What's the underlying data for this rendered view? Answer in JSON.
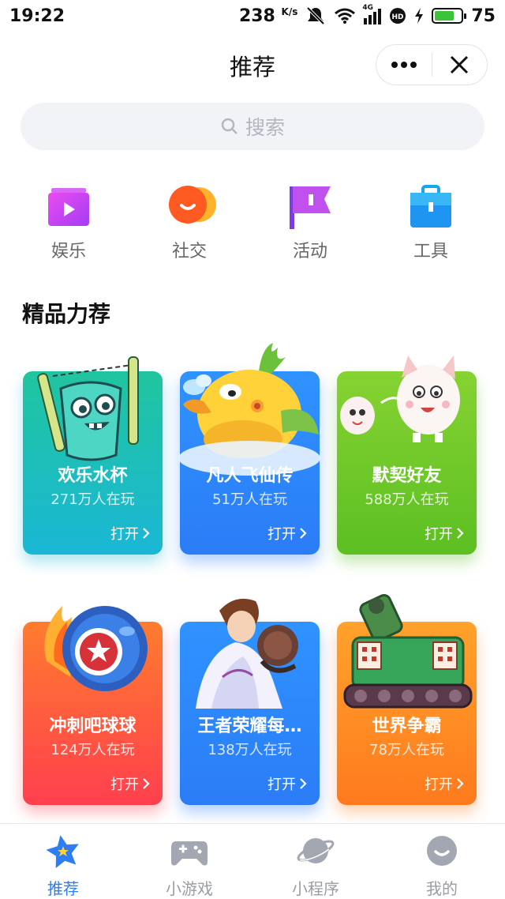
{
  "status_bar": {
    "time": "19:22",
    "speed_value": "238",
    "speed_unit": "K/s",
    "network": "4G",
    "battery": "75",
    "battery_level": 0.75
  },
  "header": {
    "title": "推荐",
    "more_icon": "more-dots-icon",
    "close_icon": "close-icon"
  },
  "search": {
    "placeholder": "搜索"
  },
  "categories": [
    {
      "label": "娱乐",
      "icon": "play-icon",
      "color": "#c53cf3"
    },
    {
      "label": "社交",
      "icon": "chat-bubble-icon",
      "color": "#ff5a22"
    },
    {
      "label": "活动",
      "icon": "flag-icon",
      "color": "#a54cf0"
    },
    {
      "label": "工具",
      "icon": "toolbox-icon",
      "color": "#1f95f2"
    }
  ],
  "section": {
    "title": "精品力荐"
  },
  "games": [
    {
      "title": "欢乐水杯",
      "players": "271万人在玩",
      "open": "打开",
      "color": "#1ab7d6"
    },
    {
      "title": "凡人飞仙传",
      "players": "51万人在玩",
      "open": "打开",
      "color": "#2b7cf6"
    },
    {
      "title": "默契好友",
      "players": "588万人在玩",
      "open": "打开",
      "color": "#5cbf22"
    },
    {
      "title": "冲刺吧球球",
      "players": "124万人在玩",
      "open": "打开",
      "color": "#ff3f4e"
    },
    {
      "title": "王者荣耀每…",
      "players": "138万人在玩",
      "open": "打开",
      "color": "#2b7cf6"
    },
    {
      "title": "世界争霸",
      "players": "78万人在玩",
      "open": "打开",
      "color": "#ff7a1e"
    }
  ],
  "tabbar": {
    "tabs": [
      {
        "label": "推荐",
        "icon": "star-icon",
        "active": true
      },
      {
        "label": "小游戏",
        "icon": "gamepad-icon",
        "active": false
      },
      {
        "label": "小程序",
        "icon": "planet-icon",
        "active": false
      },
      {
        "label": "我的",
        "icon": "smile-face-icon",
        "active": false
      }
    ],
    "active_color": "#2d7ef5",
    "inactive_color": "#9a9da5"
  }
}
